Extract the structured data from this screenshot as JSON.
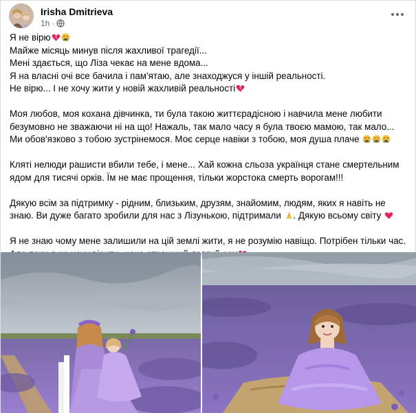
{
  "post": {
    "author": "Irisha Dmitrieva",
    "time": "1h",
    "paragraphs": [
      [
        {
          "text": "Я не вірю",
          "emoji": [
            "heart-broken-icon",
            "crying-face-icon"
          ]
        },
        {
          "text": "Майже місяць минув після жахливої трагедії..."
        },
        {
          "text": "Мені здається, що Ліза чекає на мене вдома..."
        },
        {
          "text": "Я на власні очі все бачила і  пам'ятаю, але знаходжуся у іншій реальності."
        },
        {
          "text": "Не вірю... І не хочу жити у новій жахливій реальності",
          "emoji": [
            "heart-broken-icon"
          ]
        }
      ],
      [
        {
          "text": "Моя любов, моя кохана дівчинка, ти була такою життєрадісною і навчила мене любити"
        },
        {
          "text": "безумовно не зважаючи ні на що! Нажаль, так мало часу я була твоєю мамою,  так мало..."
        },
        {
          "text": "Ми обов'язково з тобою зустрінемося. Моє серце навіки з тобою, моя душа плаче ",
          "emoji": [
            "crying-face-icon",
            "crying-face-icon",
            "crying-face-icon"
          ]
        }
      ],
      [
        {
          "text": "Кляті нелюди рашисти вбили тебе, і мене... Хай кожна сльоза українця стане смертельним"
        },
        {
          "text": "ядом для тисячі орків. Їм не має прощення, тільки жорстока смерть ворогам!!!"
        }
      ],
      [
        {
          "text": "Дякую всім за підтримку - рідним, близьким, друзям, знайомим, людям, яких я навіть не"
        },
        {
          "text": "знаю. Ви дуже багато зробили для нас з Лізунькою, підтримали ",
          "emoji": [
            "praying-hands-icon"
          ],
          "after": ". Дякую всьому світу ",
          "emoji_after": [
            "red-heart-icon"
          ]
        }
      ],
      [
        {
          "text": "Я не знаю чому мене залишили на цій землі жити, я не розумію навіщо. Потрібен тільки час."
        },
        {
          "text": "Але поки я не хочу вірити, наче страшний довгий сон",
          "emoji": [
            "heart-broken-icon"
          ]
        }
      ]
    ]
  },
  "colors": {
    "text": "#050505",
    "secondary": "#65676b",
    "heart": "#e0245e",
    "lavender": "#9b7fd0",
    "sky": "#b9c3cc"
  },
  "photos": [
    {
      "icon": "photo-mother-daughter-lavender"
    },
    {
      "icon": "photo-girl-lavender-field"
    }
  ]
}
